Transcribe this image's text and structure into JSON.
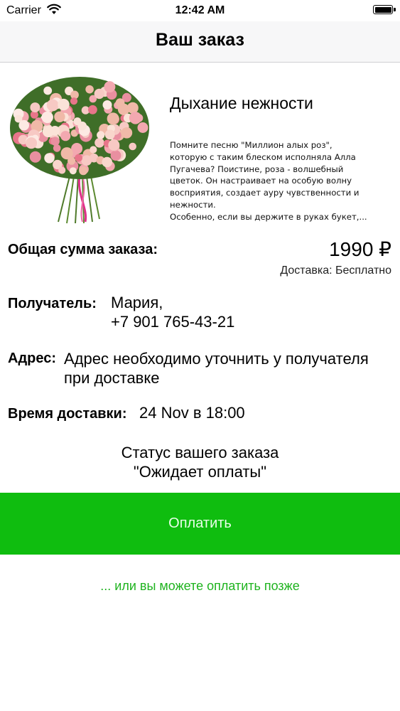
{
  "status_bar": {
    "carrier": "Carrier",
    "time": "12:42 AM",
    "wifi_icon": "wifi-icon",
    "battery_icon": "battery-icon"
  },
  "header": {
    "title": "Ваш заказ"
  },
  "product": {
    "image_icon": "flower-bouquet-image",
    "name": "Дыхание нежности",
    "description_lines": [
      "Помните песню \"Миллион алых роз\",",
      "которую с таким блеском исполняла Алла",
      "Пугачева? Поистине, роза - волшебный",
      "цветок. Он настраивает на особую волну",
      "восприятия, создает ауру чувственности и",
      "нежности.",
      "Особенно, если вы держите в руках букет,..."
    ]
  },
  "order": {
    "total_label": "Общая сумма заказа:",
    "total_value": "1990 ₽",
    "delivery": "Доставка: Бесплатно",
    "recipient_label": "Получатель:",
    "recipient_name": "Мария,",
    "recipient_phone": "+7 901 765-43-21",
    "address_label": "Адрес:",
    "address_value": "Адрес необходимо уточнить у получателя при доставке",
    "time_label": "Время доставки:",
    "time_value": "24 Nov в 18:00",
    "status_caption": "Статус вашего заказа",
    "status_value": "\"Ожидает оплаты\""
  },
  "actions": {
    "pay_label": "Оплатить",
    "pay_later": "... или вы можете оплатить позже"
  },
  "colors": {
    "accent_green": "#0fbd0f",
    "link_green": "#1fb31f",
    "navbar_bg": "#f7f7f8"
  }
}
